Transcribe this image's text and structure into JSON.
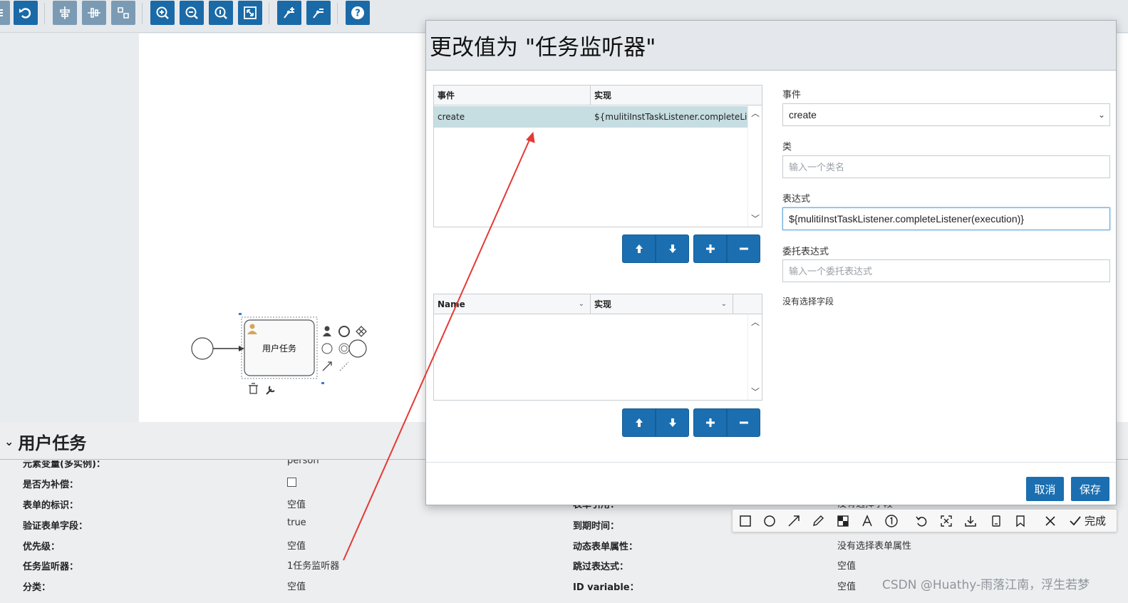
{
  "toolbar": {
    "icons": [
      "menu-icon",
      "undo-icon",
      "align-horizontal-icon",
      "align-vertical-icon",
      "same-size-icon",
      "zoom-in-icon",
      "zoom-out-icon",
      "zoom-actual-icon",
      "zoom-fit-icon",
      "bendpoint-add-icon",
      "bendpoint-remove-icon",
      "help-icon"
    ]
  },
  "diagram": {
    "task_label": "用户任务"
  },
  "properties": {
    "title": "用户任务",
    "rows": [
      {
        "label": "元素变量(多实例)：",
        "value": "person"
      },
      {
        "label": "是否为补偿：",
        "value": ""
      },
      {
        "label": "表单的标识：",
        "value": "空值"
      },
      {
        "label": "验证表单字段：",
        "value": "true"
      },
      {
        "label": "优先级：",
        "value": "空值"
      },
      {
        "label": "任务监听器：",
        "value": "1任务监听器"
      },
      {
        "label": "分类：",
        "value": "空值"
      }
    ],
    "right_rows": [
      {
        "label": "表单引用：",
        "value": "没有选择字段"
      },
      {
        "label": "到期时间：",
        "value": ""
      },
      {
        "label": "动态表单属性：",
        "value": "没有选择表单属性"
      },
      {
        "label": "跳过表达式：",
        "value": "空值"
      },
      {
        "label": "ID variable：",
        "value": "空值"
      }
    ]
  },
  "modal": {
    "title": "更改值为 \"任务监听器\"",
    "listener_grid": {
      "columns": [
        "事件",
        "实现"
      ],
      "rows": [
        {
          "event": "create",
          "impl": "${mulitiInstTaskListener.completeLi..."
        }
      ]
    },
    "field_grid": {
      "columns": [
        "Name",
        "实现"
      ]
    },
    "form": {
      "event_label": "事件",
      "event_value": "create",
      "class_label": "类",
      "class_placeholder": "输入一个类名",
      "expression_label": "表达式",
      "expression_value": "${mulitiInstTaskListener.completeListener(execution)}",
      "delegate_label": "委托表达式",
      "delegate_placeholder": "输入一个委托表达式",
      "no_field": "没有选择字段"
    },
    "cancel_label": "取消",
    "save_label": "保存"
  },
  "annotation_toolbar": {
    "done_label": "完成"
  },
  "watermark": "CSDN @Huathy-雨落江南，浮生若梦",
  "colors": {
    "accent": "#1b6fb0",
    "selected_row": "#c6dde2",
    "arrow": "#e53935"
  }
}
